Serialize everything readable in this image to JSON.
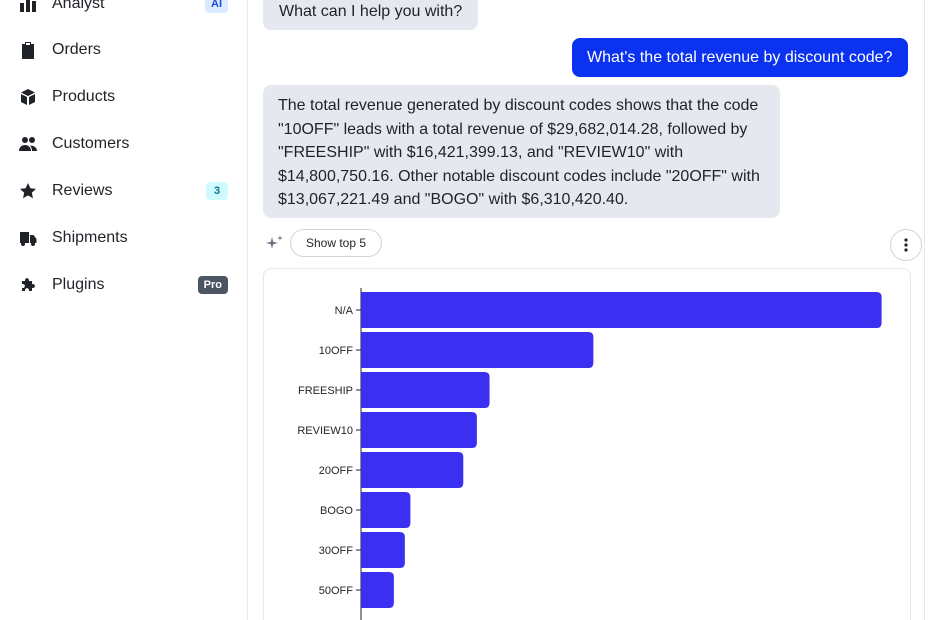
{
  "sidebar": {
    "items": [
      {
        "label": "Analyst",
        "icon": "bar-chart-icon",
        "badge": "AI"
      },
      {
        "label": "Orders",
        "icon": "clipboard-icon"
      },
      {
        "label": "Products",
        "icon": "box-icon"
      },
      {
        "label": "Customers",
        "icon": "users-icon"
      },
      {
        "label": "Reviews",
        "icon": "star-icon",
        "badge": "3"
      },
      {
        "label": "Shipments",
        "icon": "truck-icon"
      },
      {
        "label": "Plugins",
        "icon": "puzzle-icon",
        "badge": "Pro"
      }
    ]
  },
  "chat": {
    "greeting": "What can I help you with?",
    "user_question": "What's the total revenue by discount code?",
    "answer_lines": [
      "The total revenue generated by discount codes shows that the code",
      "\"10OFF\" leads with a total revenue of $29,682,014.28, followed by",
      "\"FREESHIP\" with $16,421,399.13, and \"REVIEW10\" with",
      "$14,800,750.16. Other notable discount codes include \"20OFF\" with",
      "$13,067,221.49 and \"BOGO\" with $6,310,420.40."
    ],
    "suggestion_label": "Show top 5"
  },
  "colors": {
    "bar": "#3b2ff2",
    "user_bubble": "#0a32f0",
    "assistant_bubble": "#e5e9ef"
  },
  "chart_data": {
    "type": "bar",
    "orientation": "horizontal",
    "categories": [
      "N/A",
      "10OFF",
      "FREESHIP",
      "REVIEW10",
      "20OFF",
      "BOGO",
      "30OFF",
      "50OFF"
    ],
    "values": [
      66500000,
      29682014.28,
      16421399.13,
      14800750.16,
      13067221.49,
      6310420.4,
      5600000,
      4200000
    ],
    "xlim": [
      0,
      70000000
    ],
    "x_tick_values": [
      0,
      10000000,
      20000000,
      30000000,
      40000000,
      50000000,
      60000000
    ],
    "title": "",
    "xlabel": "",
    "ylabel": ""
  }
}
